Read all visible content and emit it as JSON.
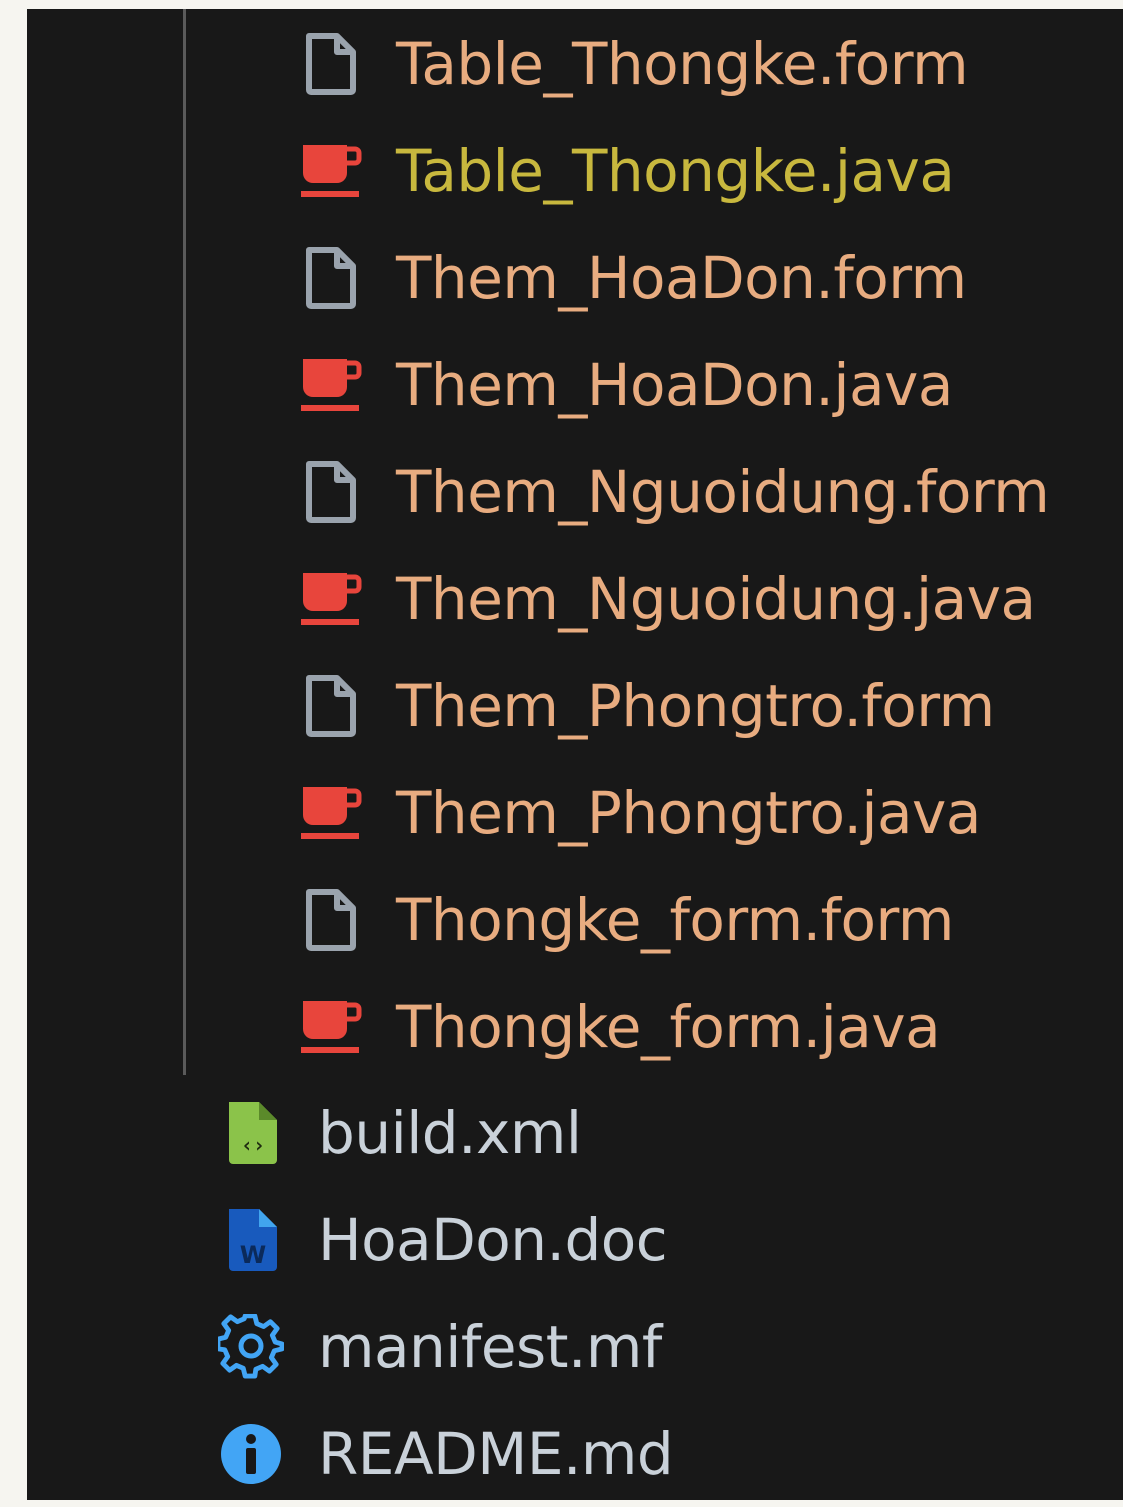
{
  "explorer": {
    "nested_files": [
      {
        "name": "Table_Thongke.form",
        "icon": "file-icon",
        "color": "#e8ac80"
      },
      {
        "name": "Table_Thongke.java",
        "icon": "java-icon",
        "color": "#c8b83e"
      },
      {
        "name": "Them_HoaDon.form",
        "icon": "file-icon",
        "color": "#e8ac80"
      },
      {
        "name": "Them_HoaDon.java",
        "icon": "java-icon",
        "color": "#e8ac80"
      },
      {
        "name": "Them_Nguoidung.form",
        "icon": "file-icon",
        "color": "#e8ac80"
      },
      {
        "name": "Them_Nguoidung.java",
        "icon": "java-icon",
        "color": "#e8ac80"
      },
      {
        "name": "Them_Phongtro.form",
        "icon": "file-icon",
        "color": "#e8ac80"
      },
      {
        "name": "Them_Phongtro.java",
        "icon": "java-icon",
        "color": "#e8ac80"
      },
      {
        "name": "Thongke_form.form",
        "icon": "file-icon",
        "color": "#e8ac80"
      },
      {
        "name": "Thongke_form.java",
        "icon": "java-icon",
        "color": "#e8ac80"
      }
    ],
    "root_files": [
      {
        "name": "build.xml",
        "icon": "xml-file-icon",
        "color": "#c9d1d9"
      },
      {
        "name": "HoaDon.doc",
        "icon": "word-file-icon",
        "color": "#c9d1d9"
      },
      {
        "name": "manifest.mf",
        "icon": "gear-icon",
        "color": "#c9d1d9"
      },
      {
        "name": "README.md",
        "icon": "info-icon",
        "color": "#c9d1d9"
      }
    ]
  }
}
